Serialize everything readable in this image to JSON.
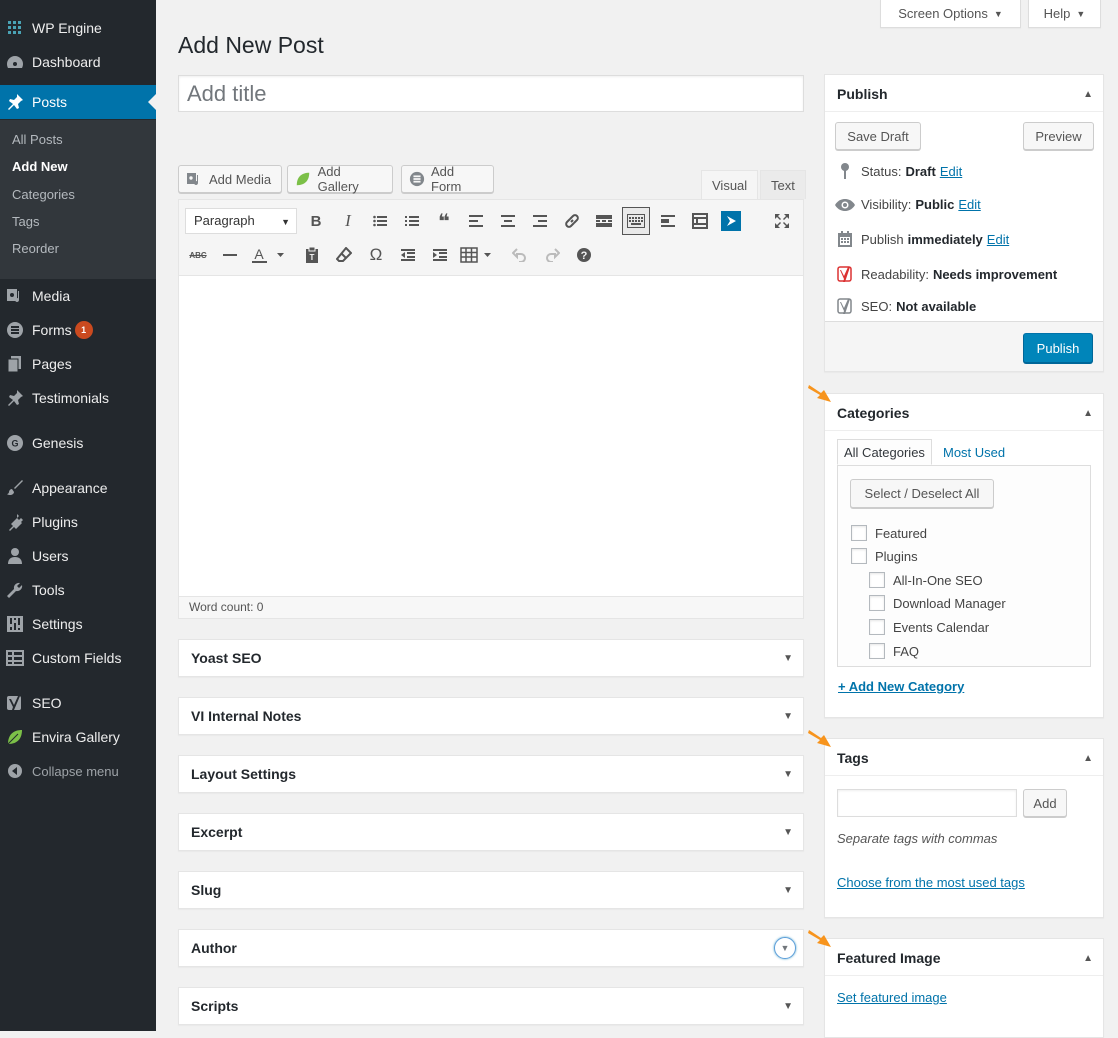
{
  "sidebar": {
    "top_items": [
      {
        "label": "WP Engine",
        "icon": "grid-icon"
      },
      {
        "label": "Dashboard",
        "icon": "dashboard-icon"
      },
      {
        "label": "Posts",
        "icon": "pin-icon"
      }
    ],
    "submenu": [
      "All Posts",
      "Add New",
      "Categories",
      "Tags",
      "Reorder"
    ],
    "items": [
      {
        "label": "Media",
        "icon": "media-icon"
      },
      {
        "label": "Forms",
        "icon": "forms-icon",
        "badge": "1"
      },
      {
        "label": "Pages",
        "icon": "pages-icon"
      },
      {
        "label": "Testimonials",
        "icon": "pin-icon"
      },
      {
        "label": "Genesis",
        "icon": "genesis-icon"
      },
      {
        "label": "Appearance",
        "icon": "brush-icon"
      },
      {
        "label": "Plugins",
        "icon": "plug-icon"
      },
      {
        "label": "Users",
        "icon": "user-icon"
      },
      {
        "label": "Tools",
        "icon": "wrench-icon"
      },
      {
        "label": "Settings",
        "icon": "sliders-icon"
      },
      {
        "label": "Custom Fields",
        "icon": "table-icon"
      },
      {
        "label": "SEO",
        "icon": "yoast-icon"
      },
      {
        "label": "Envira Gallery",
        "icon": "leaf-icon"
      }
    ],
    "collapse": "Collapse menu"
  },
  "header": {
    "screen_options": "Screen Options",
    "help": "Help",
    "page_title": "Add New Post",
    "title_placeholder": "Add title"
  },
  "editor": {
    "add_media": "Add Media",
    "add_gallery": "Add Gallery",
    "add_form": "Add Form",
    "tab_visual": "Visual",
    "tab_text": "Text",
    "format_select": "Paragraph",
    "word_count": "Word count: 0"
  },
  "metaboxes": [
    "Yoast SEO",
    "VI Internal Notes",
    "Layout Settings",
    "Excerpt",
    "Slug",
    "Author",
    "Scripts"
  ],
  "publish": {
    "title": "Publish",
    "save_draft": "Save Draft",
    "preview": "Preview",
    "status_label": "Status:",
    "status_value": "Draft",
    "visibility_label": "Visibility:",
    "visibility_value": "Public",
    "publish_label": "Publish",
    "publish_value": "immediately",
    "readability_label": "Readability:",
    "readability_value": "Needs improvement",
    "seo_label": "SEO:",
    "seo_value": "Not available",
    "edit": "Edit",
    "publish_button": "Publish"
  },
  "categories": {
    "title": "Categories",
    "tab_all": "All Categories",
    "tab_most_used": "Most Used",
    "select_all": "Select / Deselect All",
    "items": [
      "Featured",
      "Plugins",
      "All-In-One SEO",
      "Download Manager",
      "Events Calendar",
      "FAQ"
    ],
    "add_new": "+ Add New Category"
  },
  "tags": {
    "title": "Tags",
    "add_button": "Add",
    "hint": "Separate tags with commas",
    "choose": "Choose from the most used tags"
  },
  "featured_image": {
    "title": "Featured Image",
    "set_link": "Set featured image"
  },
  "colors": {
    "sidebar_bg": "#23282d",
    "accent": "#0073aa",
    "primary_button": "#0085ba",
    "badge": "#ca4a1f",
    "annotation_arrow": "#f7941d"
  }
}
